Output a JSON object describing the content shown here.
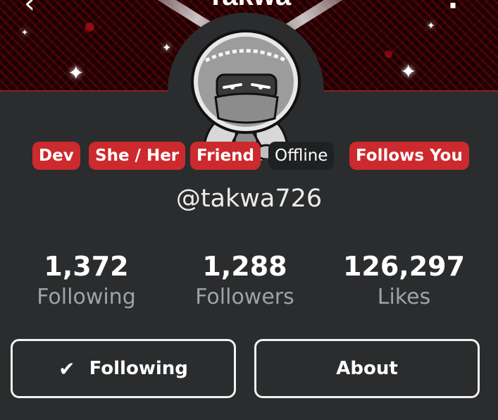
{
  "header": {
    "title": "• Takwa •",
    "back_icon": "chevron-left-icon",
    "menu_icon": "more-vertical-icon",
    "banner_colors": [
      "#2a0406",
      "#cc2a2e",
      "#ffffff"
    ]
  },
  "profile": {
    "handle": "@takwa726",
    "tags": [
      {
        "label": "Dev",
        "color": "#cc2a2e"
      },
      {
        "label": "She / Her",
        "color": "#cc2a2e"
      },
      {
        "label": "Friend",
        "color": "#cc2a2e"
      },
      {
        "label": "Offline",
        "color": "#1f2021"
      },
      {
        "label": "Follows You",
        "color": "#cc2a2e"
      }
    ]
  },
  "stats": [
    {
      "value": "1,372",
      "label": "Following"
    },
    {
      "value": "1,288",
      "label": "Followers"
    },
    {
      "value": "126,297",
      "label": "Likes"
    }
  ],
  "actions": {
    "following_label": "Following",
    "following_icon": "check-icon",
    "about_label": "About"
  },
  "theme": {
    "background": "#2b2c2d",
    "accent": "#cc2a2e",
    "muted_text": "#a0a2a5"
  }
}
